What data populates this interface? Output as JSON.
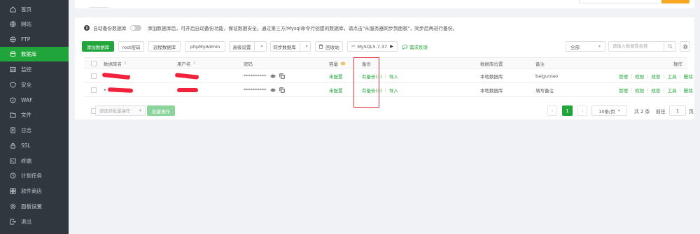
{
  "sidebar": {
    "items": [
      {
        "label": "首页",
        "icon": "home-icon"
      },
      {
        "label": "网站",
        "icon": "globe-icon"
      },
      {
        "label": "FTP",
        "icon": "ftp-icon"
      },
      {
        "label": "数据库",
        "icon": "database-icon",
        "active": true
      },
      {
        "label": "监控",
        "icon": "monitor-icon"
      },
      {
        "label": "安全",
        "icon": "shield-icon"
      },
      {
        "label": "WAF",
        "icon": "waf-icon"
      },
      {
        "label": "文件",
        "icon": "folder-icon"
      },
      {
        "label": "日志",
        "icon": "log-icon"
      },
      {
        "label": "SSL",
        "icon": "ssl-icon"
      },
      {
        "label": "终端",
        "icon": "terminal-icon"
      },
      {
        "label": "计划任务",
        "icon": "clock-icon"
      },
      {
        "label": "软件商店",
        "icon": "store-icon"
      },
      {
        "label": "面板设置",
        "icon": "settings-icon"
      },
      {
        "label": "退出",
        "icon": "logout-icon"
      }
    ]
  },
  "notice": {
    "toggle_label": "自动备份数据库",
    "text": "添加数据库后，可开启自动备份功能，保证数据安全。通过第三方/Mysql命令行创建的数据库，请点击\"从服务器同步到面板\"，同步后再进行备份。"
  },
  "toolbar": {
    "add": "添加数据库",
    "root_pwd": "root密码",
    "remote": "远程数据库",
    "phpmyadmin": "phpMyAdmin",
    "advanced": "高级设置",
    "sync": "同步数据库",
    "recycle": "回收站",
    "mysql_version": "MySQL5.7.37",
    "feedback": "需求反馈",
    "filter": "全部",
    "search_placeholder": "请输入数据库名称"
  },
  "table": {
    "headers": {
      "name": "数据库名",
      "user": "用户名",
      "password": "密码",
      "capacity": "容量",
      "backup": "备份",
      "location": "数据库位置",
      "remark": "备注",
      "actions": "操作"
    },
    "rows": [
      {
        "name_tail": "o",
        "user_tail": "o",
        "password": "**********",
        "capacity": "未配置",
        "backup": "有备份(1)",
        "import": "导入",
        "location": "本地数据库",
        "remark": "baiguniao"
      },
      {
        "name_tail": "",
        "user_tail": "",
        "password": "**********",
        "capacity": "未配置",
        "backup": "有备份(3)",
        "import": "导入",
        "location": "本地数据库",
        "remark": "填写备注"
      }
    ],
    "actions": [
      "管理",
      "权限",
      "改密",
      "工具",
      "删除"
    ]
  },
  "footer": {
    "batch_placeholder": "请选择批量操作",
    "batch_button": "批量操作",
    "current_page": "1",
    "page_size": "10条/页",
    "total": "共 2 条",
    "goto_label": "前往",
    "goto_value": "1",
    "page_suffix": "页"
  },
  "colors": {
    "accent": "#20a53a",
    "sidebar": "#30373f",
    "highlight_box": "#e2323c",
    "redaction": "#f0223c"
  }
}
